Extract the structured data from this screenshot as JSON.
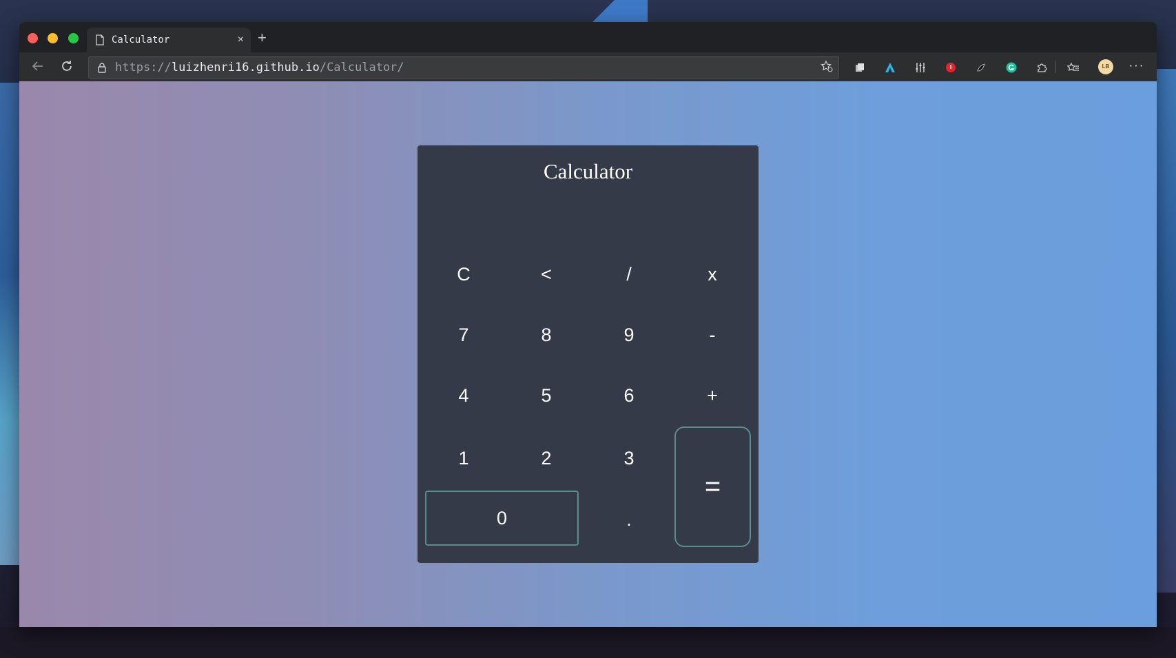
{
  "browser": {
    "tab_title": "Calculator",
    "tab_close": "×",
    "new_tab": "+",
    "url_scheme": "https://",
    "url_host": "luizhenri16.github.io",
    "url_path": "/Calculator/",
    "avatar_initials": "LB",
    "more_menu": "···"
  },
  "calculator": {
    "title": "Calculator",
    "display_value": "",
    "keys": {
      "clear": "C",
      "backspace": "<",
      "divide": "/",
      "multiply": "x",
      "seven": "7",
      "eight": "8",
      "nine": "9",
      "minus": "-",
      "four": "4",
      "five": "5",
      "six": "6",
      "plus": "+",
      "one": "1",
      "two": "2",
      "three": "3",
      "equals": "=",
      "zero": "0",
      "decimal": "."
    }
  },
  "colors": {
    "calculator_bg": "#343a47",
    "accent_border": "#5a8e8a",
    "page_gradient_start": "#9a88ac",
    "page_gradient_end": "#6b9edd"
  },
  "icons": {
    "tab_icon": "page-icon",
    "back": "back-arrow-icon",
    "reload": "reload-icon",
    "lock": "lock-icon",
    "favorite_add": "star-add-icon",
    "extensions": [
      "collections-icon",
      "ext-blue-a-icon",
      "sliders-icon",
      "ext-red-icon",
      "ext-black-icon",
      "grammarly-icon",
      "puzzle-icon",
      "favorites-icon"
    ]
  }
}
